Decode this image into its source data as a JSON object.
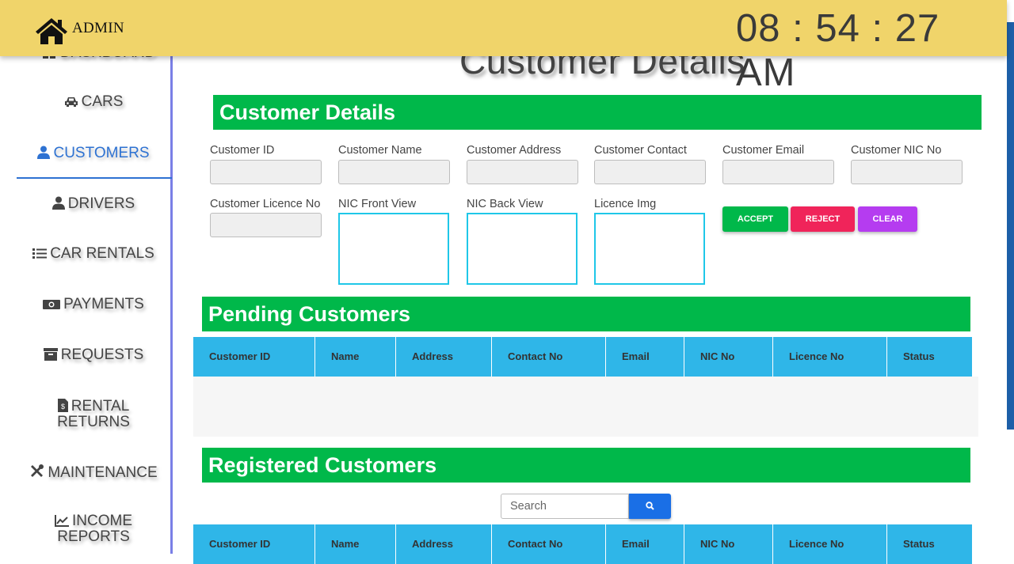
{
  "header": {
    "brand": "ADMIN",
    "clock": "08 : 54 : 27 AM"
  },
  "sidebar": {
    "hidden_item": "DASHBOARD",
    "items": [
      {
        "label": "CARS",
        "icon": "car-icon"
      },
      {
        "label": "CUSTOMERS",
        "icon": "user-icon",
        "active": true
      },
      {
        "label": "DRIVERS",
        "icon": "user-icon"
      },
      {
        "label": "CAR RENTALS",
        "icon": "list-icon"
      },
      {
        "label": "PAYMENTS",
        "icon": "money-icon"
      },
      {
        "label": "REQUESTS",
        "icon": "archive-icon"
      },
      {
        "label_line1": "RENTAL",
        "label_line2": "RETURNS",
        "icon": "invoice-icon"
      },
      {
        "label": "MAINTENANCE",
        "icon": "tools-icon"
      },
      {
        "label_line1": "INCOME",
        "label_line2": "REPORTS",
        "icon": "chart-line-icon"
      }
    ]
  },
  "page_title": "Customer Details",
  "customer_form": {
    "section_title": "Customer Details",
    "fields": [
      {
        "label": "Customer ID",
        "value": ""
      },
      {
        "label": "Customer Name",
        "value": ""
      },
      {
        "label": "Customer Address",
        "value": ""
      },
      {
        "label": "Customer Contact",
        "value": ""
      },
      {
        "label": "Customer Email",
        "value": ""
      },
      {
        "label": "Customer NIC No",
        "value": ""
      },
      {
        "label": "Customer Licence No",
        "value": ""
      }
    ],
    "images": [
      {
        "label": "NIC Front View"
      },
      {
        "label": "NIC Back View"
      },
      {
        "label": "Licence Img"
      }
    ],
    "buttons": {
      "accept": "ACCEPT",
      "reject": "REJECT",
      "clear": "CLEAR"
    }
  },
  "pending": {
    "section_title": "Pending Customers",
    "columns": [
      "Customer ID",
      "Name",
      "Address",
      "Contact No",
      "Email",
      "NIC No",
      "Licence No",
      "Status"
    ],
    "rows": []
  },
  "registered": {
    "section_title": "Registered Customers",
    "search_placeholder": "Search",
    "columns": [
      "Customer ID",
      "Name",
      "Address",
      "Contact No",
      "Email",
      "NIC No",
      "Licence No",
      "Status"
    ]
  },
  "colors": {
    "topbar": "#f0d46a",
    "section_green": "#00b84a",
    "table_header": "#2fb6e8",
    "accept": "#00b84a",
    "reject": "#f0245a",
    "clear": "#b53cf0",
    "search_button": "#1a6fe6",
    "active_nav": "#2e72d2"
  }
}
